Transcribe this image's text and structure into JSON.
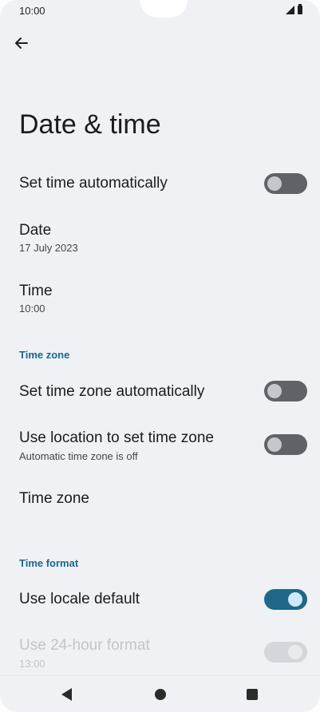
{
  "status_bar": {
    "time": "10:00",
    "icons": [
      "signal-icon",
      "battery-icon"
    ]
  },
  "header": {
    "title": "Date & time",
    "back_icon": "arrow-left-icon"
  },
  "settings": {
    "set_time_auto": {
      "label": "Set time automatically",
      "enabled": false
    },
    "date": {
      "label": "Date",
      "value": "17 July 2023"
    },
    "time": {
      "label": "Time",
      "value": "10:00"
    },
    "time_zone_section": {
      "label": "Time zone"
    },
    "set_tz_auto": {
      "label": "Set time zone automatically",
      "enabled": false
    },
    "use_location_tz": {
      "label": "Use location to set time zone",
      "summary": "Automatic time zone is off",
      "enabled": false
    },
    "time_zone": {
      "label": "Time zone"
    },
    "time_format_section": {
      "label": "Time format"
    },
    "use_locale_default": {
      "label": "Use locale default",
      "enabled": true
    },
    "use_24h": {
      "label": "Use 24-hour format",
      "summary": "13:00",
      "enabled": true,
      "disabled": true
    }
  },
  "nav_bar": {
    "icons": [
      "back-triangle-icon",
      "home-circle-icon",
      "recents-square-icon"
    ]
  },
  "colors": {
    "accent": "#1f6889",
    "section_header": "#1d6789",
    "background": "#f0f1f4"
  }
}
